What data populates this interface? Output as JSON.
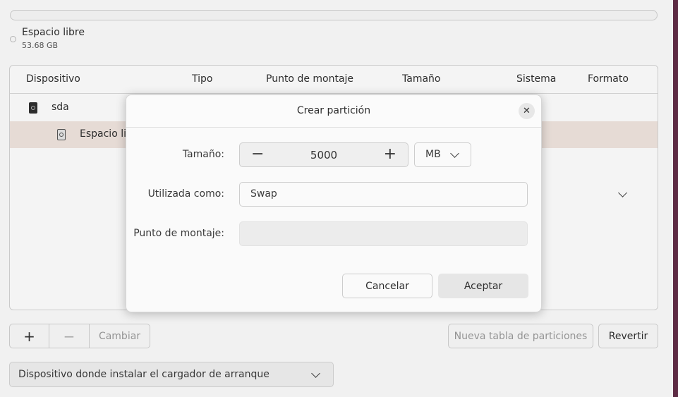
{
  "legend": {
    "name": "Espacio libre",
    "size": "53.68 GB"
  },
  "table": {
    "columns": [
      "Dispositivo",
      "Tipo",
      "Punto de montaje",
      "Tamaño",
      "Sistema",
      "Formato"
    ],
    "rows": [
      {
        "device": "sda",
        "icon": "drive-icon"
      },
      {
        "device": "Espacio libre",
        "icon": "partition-icon"
      }
    ]
  },
  "toolbar": {
    "add": "+",
    "remove": "−",
    "change": "Cambiar",
    "new_table": "Nueva tabla de particiones",
    "revert": "Revertir"
  },
  "bootloader": {
    "label": "Dispositivo donde instalar el cargador de arranque"
  },
  "dialog": {
    "title": "Crear partición",
    "close": "✕",
    "size_label": "Tamaño:",
    "size_value": "5000",
    "size_unit": "MB",
    "use_label": "Utilizada como:",
    "use_value": "Swap",
    "mount_label": "Punto de montaje:",
    "mount_value": "",
    "cancel": "Cancelar",
    "accept": "Aceptar"
  }
}
